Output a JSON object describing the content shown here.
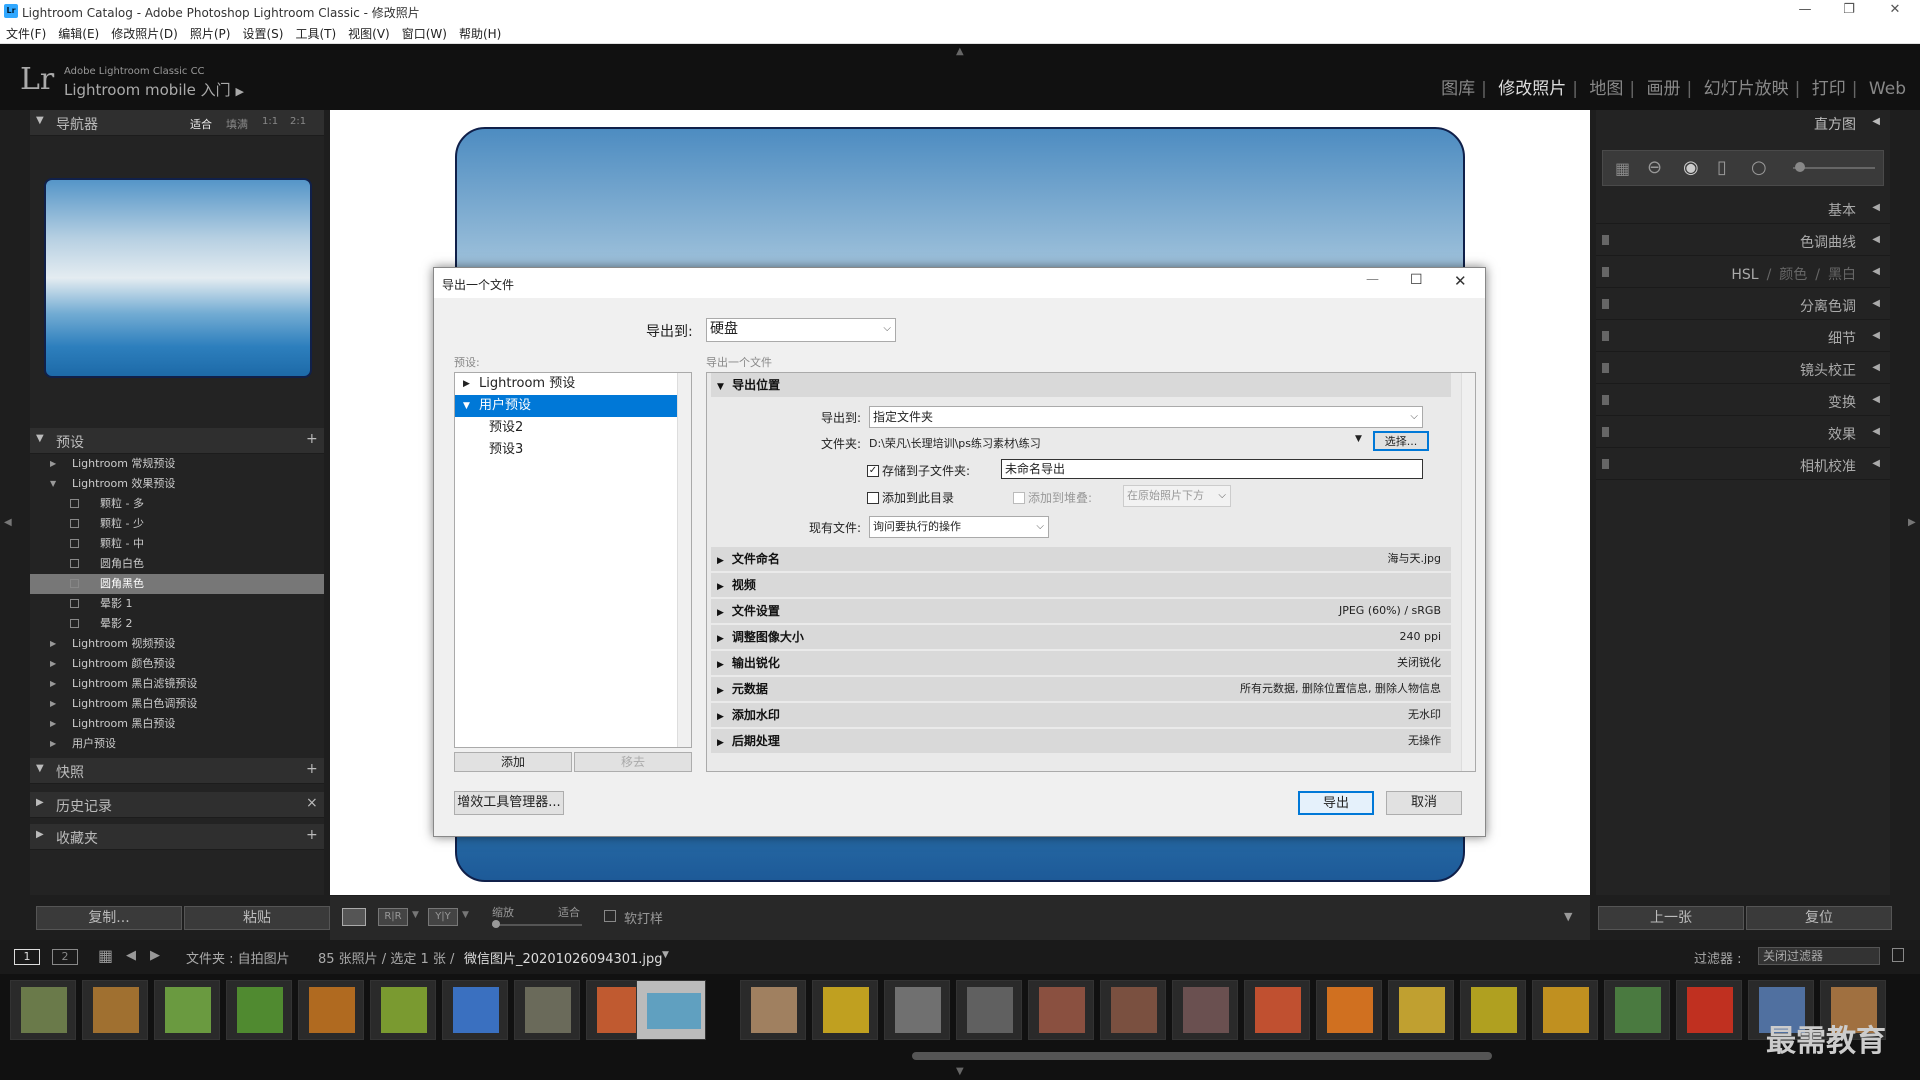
{
  "window": {
    "title": "Lightroom Catalog - Adobe Photoshop Lightroom Classic - 修改照片",
    "app_icon": "Lr"
  },
  "menu": [
    "文件(F)",
    "编辑(E)",
    "修改照片(D)",
    "照片(P)",
    "设置(S)",
    "工具(T)",
    "视图(V)",
    "窗口(W)",
    "帮助(H)"
  ],
  "identity": {
    "logo": "Lr",
    "line1": "Adobe Lightroom Classic CC",
    "line2": "Lightroom mobile 入门"
  },
  "modules": [
    "图库",
    "修改照片",
    "地图",
    "画册",
    "幻灯片放映",
    "打印",
    "Web"
  ],
  "navigator": {
    "title": "导航器",
    "zoom": [
      "适合",
      "填满",
      "1:1",
      "2:1"
    ]
  },
  "presets": {
    "title": "预设",
    "items": [
      {
        "label": "Lightroom 常规预设",
        "level": 0,
        "open": false
      },
      {
        "label": "Lightroom 效果预设",
        "level": 0,
        "open": true
      },
      {
        "label": "颗粒 - 多",
        "level": 1
      },
      {
        "label": "颗粒 - 少",
        "level": 1
      },
      {
        "label": "颗粒 - 中",
        "level": 1
      },
      {
        "label": "圆角白色",
        "level": 1
      },
      {
        "label": "圆角黑色",
        "level": 1,
        "selected": true
      },
      {
        "label": "晕影 1",
        "level": 1
      },
      {
        "label": "晕影 2",
        "level": 1
      },
      {
        "label": "Lightroom 视频预设",
        "level": 0
      },
      {
        "label": "Lightroom 颜色预设",
        "level": 0
      },
      {
        "label": "Lightroom 黑白滤镜预设",
        "level": 0
      },
      {
        "label": "Lightroom 黑白色调预设",
        "level": 0
      },
      {
        "label": "Lightroom 黑白预设",
        "level": 0
      },
      {
        "label": "用户预设",
        "level": 0
      }
    ]
  },
  "left_panels": [
    {
      "title": "快照",
      "action": "+"
    },
    {
      "title": "历史记录",
      "action": "×"
    },
    {
      "title": "收藏夹",
      "action": "+"
    }
  ],
  "left_buttons": {
    "copy": "复制...",
    "paste": "粘贴"
  },
  "right_panels": [
    "直方图",
    "基本",
    "色调曲线",
    "HSL / 颜色 / 黑白",
    "分离色调",
    "细节",
    "镜头校正",
    "变换",
    "效果",
    "相机校准"
  ],
  "hsl_parts": [
    "HSL",
    "/",
    "颜色",
    "/",
    "黑白"
  ],
  "right_buttons": {
    "prev": "上一张",
    "reset": "复位"
  },
  "toolbar": {
    "zoom": "缩放",
    "fit": "适合",
    "softproof": "软打样"
  },
  "filmstrip": {
    "tabs": [
      "1",
      "2"
    ],
    "folder": "文件夹 : 自拍图片",
    "count": "85 张照片 / 选定 1 张 /",
    "filename": "微信图片_20201026094301.jpg",
    "filter_label": "过滤器 :",
    "filter_value": "关闭过滤器"
  },
  "watermark": "最需教育",
  "dialog": {
    "title": "导出一个文件",
    "export_to_label": "导出到:",
    "export_to_value": "硬盘",
    "presets_label": "预设:",
    "subtitle": "导出一个文件",
    "preset_tree": [
      {
        "label": "Lightroom 预设",
        "level": 0,
        "selected": false
      },
      {
        "label": "用户预设",
        "level": 0,
        "selected": true
      },
      {
        "label": "预设2",
        "level": 1,
        "selected": false
      },
      {
        "label": "预设3",
        "level": 1,
        "selected": false
      }
    ],
    "add_btn": "添加",
    "remove_btn": "移去",
    "plugin_btn": "增效工具管理器...",
    "export_btn": "导出",
    "cancel_btn": "取消",
    "location": {
      "header": "导出位置",
      "export_to_label": "导出到:",
      "export_to_value": "指定文件夹",
      "folder_label": "文件夹:",
      "folder_value": "D:\\荣凡\\长理培训\\ps练习素材\\练习",
      "choose_btn": "选择...",
      "subfolder_label": "存储到子文件夹:",
      "subfolder_value": "未命名导出",
      "add_catalog_label": "添加到此目录",
      "add_stack_label": "添加到堆叠:",
      "stack_value": "在原始照片下方",
      "existing_label": "现有文件:",
      "existing_value": "询问要执行的操作"
    },
    "sections": [
      {
        "label": "文件命名",
        "value": "海与天.jpg"
      },
      {
        "label": "视频",
        "value": ""
      },
      {
        "label": "文件设置",
        "value": "JPEG (60%) / sRGB"
      },
      {
        "label": "调整图像大小",
        "value": "240 ppi"
      },
      {
        "label": "输出锐化",
        "value": "关闭锐化"
      },
      {
        "label": "元数据",
        "value": "所有元数据, 删除位置信息, 删除人物信息"
      },
      {
        "label": "添加水印",
        "value": "无水印"
      },
      {
        "label": "后期处理",
        "value": "无操作"
      }
    ]
  }
}
